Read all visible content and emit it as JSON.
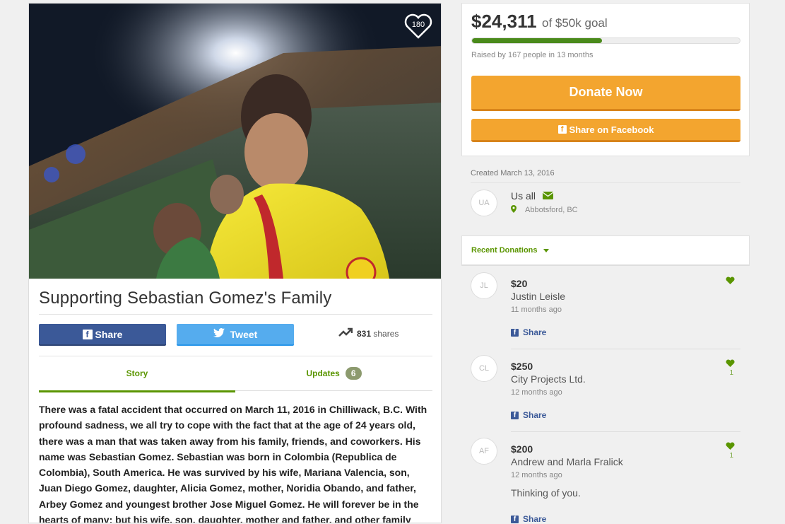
{
  "hero": {
    "like_count": "180"
  },
  "campaign": {
    "title": "Supporting Sebastian Gomez's Family",
    "share_label": "Share",
    "tweet_label": "Tweet",
    "shares_count": "831",
    "shares_suffix": "shares",
    "tabs": [
      {
        "label": "Story"
      },
      {
        "label": "Updates",
        "count": "6"
      }
    ],
    "story": "There was a fatal accident that occurred on March 11, 2016 in Chilliwack, B.C. With profound sadness, we all try to cope with the fact that at the age of 24 years old, there was a man that was taken away from his family, friends, and coworkers. His name was Sebastian Gomez. Sebastian was born in Colombia (Republica de Colombia), South America. He was survived by his wife, Mariana Valencia, son, Juan Diego Gomez, daughter, Alicia Gomez, mother, Noridia Obando, and father, Arbey Gomez and youngest brother Jose Miguel Gomez. He will forever be in the hearts of many; but his wife, son, daughter, mother and father, and other family"
  },
  "goal": {
    "raised": "$24,311",
    "goal_text": "of $50k goal",
    "progress_fraction": 0.486,
    "raised_by": "Raised by 167 people in 13 months",
    "donate_label": "Donate Now",
    "fb_share_label": "Share on Facebook"
  },
  "organizer": {
    "created": "Created March 13, 2016",
    "initials": "UA",
    "name": "Us all",
    "location": "Abbotsford, BC"
  },
  "recent": {
    "label": "Recent Donations"
  },
  "donations": [
    {
      "initials": "JL",
      "amount": "$20",
      "name": "Justin Leisle",
      "time": "11 months ago",
      "likes": "",
      "share": "Share"
    },
    {
      "initials": "CL",
      "amount": "$250",
      "name": "City Projects Ltd.",
      "time": "12 months ago",
      "likes": "1",
      "share": "Share"
    },
    {
      "initials": "AF",
      "amount": "$200",
      "name": "Andrew and Marla Fralick",
      "time": "12 months ago",
      "likes": "1",
      "message": "Thinking of you.",
      "share": "Share"
    }
  ],
  "colors": {
    "accent_green": "#5a9500",
    "progress_green": "#4a8a1b",
    "donate_orange": "#f3a52f",
    "facebook_blue": "#3b5998",
    "twitter_blue": "#55acee"
  }
}
